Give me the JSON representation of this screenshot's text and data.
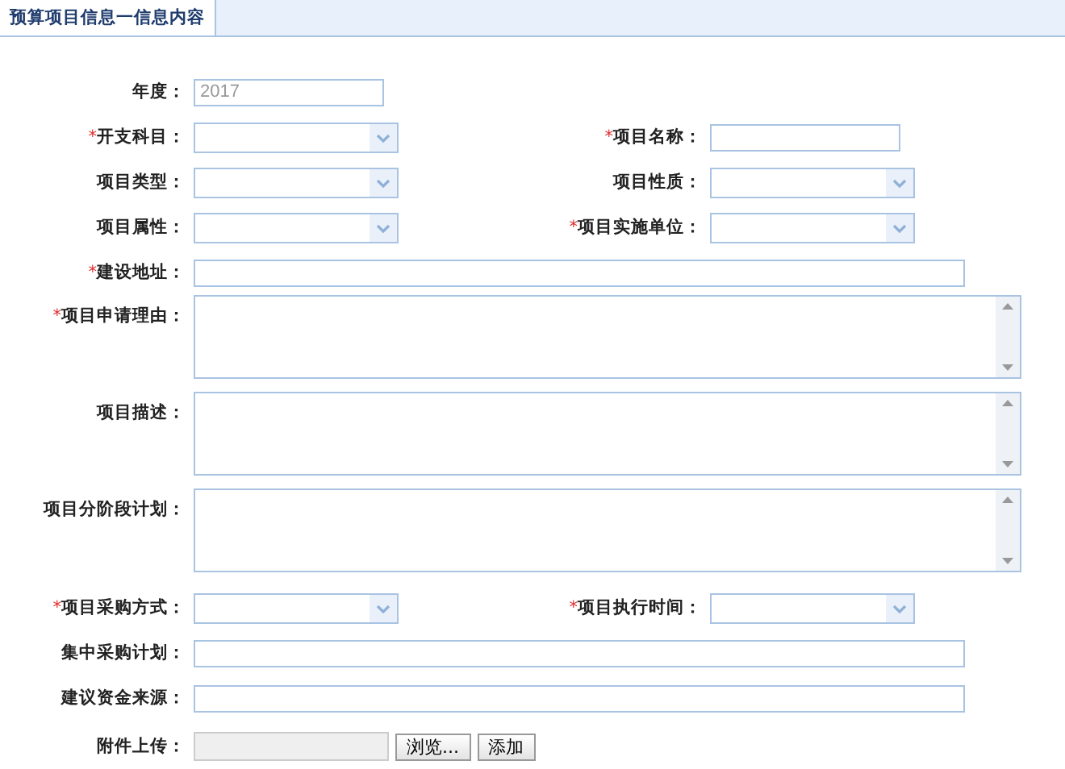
{
  "tab": {
    "label": "预算项目信息一信息内容",
    "selected": true
  },
  "rows": [
    {
      "kind": "pair",
      "fields": [
        {
          "label": "年度：",
          "kind": "text",
          "value": "2017",
          "disabled": true
        }
      ]
    },
    {
      "kind": "pair",
      "fields": [
        {
          "mark": "*",
          "label": "开支科目：",
          "kind": "select"
        },
        {
          "mark": "*",
          "label": "项目名称：",
          "kind": "text"
        }
      ]
    },
    {
      "kind": "pair",
      "fields": [
        {
          "label": "项目类型：",
          "kind": "select"
        },
        {
          "label": "项目性质：",
          "kind": "select"
        }
      ]
    },
    {
      "kind": "pair",
      "fields": [
        {
          "label": "项目属性：",
          "kind": "select"
        },
        {
          "mark": "*",
          "label": "项目实施单位：",
          "kind": "select"
        }
      ]
    },
    {
      "kind": "wide",
      "fields": [
        {
          "mark": "*",
          "label": "建设地址：",
          "kind": "text"
        }
      ]
    },
    {
      "kind": "area",
      "fields": [
        {
          "mark": "*",
          "label": "项目申请理由：",
          "kind": "textarea"
        }
      ]
    },
    {
      "kind": "area",
      "fields": [
        {
          "label": "项目描述：",
          "kind": "textarea"
        }
      ]
    },
    {
      "kind": "area",
      "fields": [
        {
          "label": "项目分阶段计划：",
          "kind": "textarea"
        }
      ]
    },
    {
      "kind": "pair",
      "fields": [
        {
          "mark": "*",
          "label": "项目采购方式：",
          "kind": "select"
        },
        {
          "mark": "*",
          "label": "项目执行时间：",
          "kind": "select"
        }
      ]
    },
    {
      "kind": "wide",
      "fields": [
        {
          "label": "集中采购计划：",
          "kind": "text"
        }
      ]
    },
    {
      "kind": "wide",
      "fields": [
        {
          "label": "建议资金来源：",
          "kind": "text"
        }
      ]
    },
    {
      "kind": "file",
      "fields": [
        {
          "label": "附件上传：",
          "kind": "file",
          "buttons": [
            "浏览...",
            "添加"
          ]
        }
      ]
    }
  ]
}
